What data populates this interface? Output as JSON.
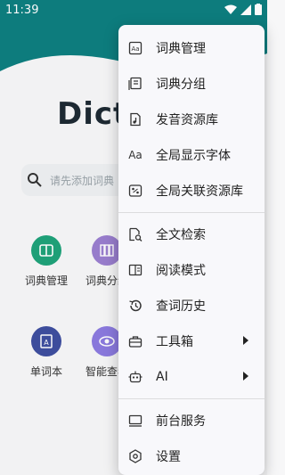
{
  "status_bar": {
    "time": "11:39"
  },
  "app": {
    "logo_text": "Dict"
  },
  "search": {
    "placeholder": "请先添加词典"
  },
  "tiles": [
    {
      "label": "词典管理"
    },
    {
      "label": "词典分组"
    },
    {
      "label": "单词本"
    },
    {
      "label": "智能查看"
    }
  ],
  "menu": {
    "items": [
      {
        "label": "词典管理",
        "icon": "dictionary-icon"
      },
      {
        "label": "词典分组",
        "icon": "group-icon"
      },
      {
        "label": "发音资源库",
        "icon": "audio-file-icon"
      },
      {
        "label": "全局显示字体",
        "icon": "font-icon",
        "icon_text": "Aa"
      },
      {
        "label": "全局关联资源库",
        "icon": "resource-icon"
      },
      {
        "label": "全文检索",
        "icon": "fulltext-search-icon"
      },
      {
        "label": "阅读模式",
        "icon": "reading-icon"
      },
      {
        "label": "查词历史",
        "icon": "history-icon"
      },
      {
        "label": "工具箱",
        "icon": "toolbox-icon"
      },
      {
        "label": "AI",
        "icon": "robot-icon"
      },
      {
        "label": "前台服务",
        "icon": "monitor-icon"
      },
      {
        "label": "设置",
        "icon": "settings-icon"
      }
    ]
  },
  "colors": {
    "brand": "#0e7f80",
    "accent_yellow": "#f4b400",
    "green": "#1fa37a",
    "purple": "#9b7fd0",
    "indigo": "#3f4fa0"
  }
}
